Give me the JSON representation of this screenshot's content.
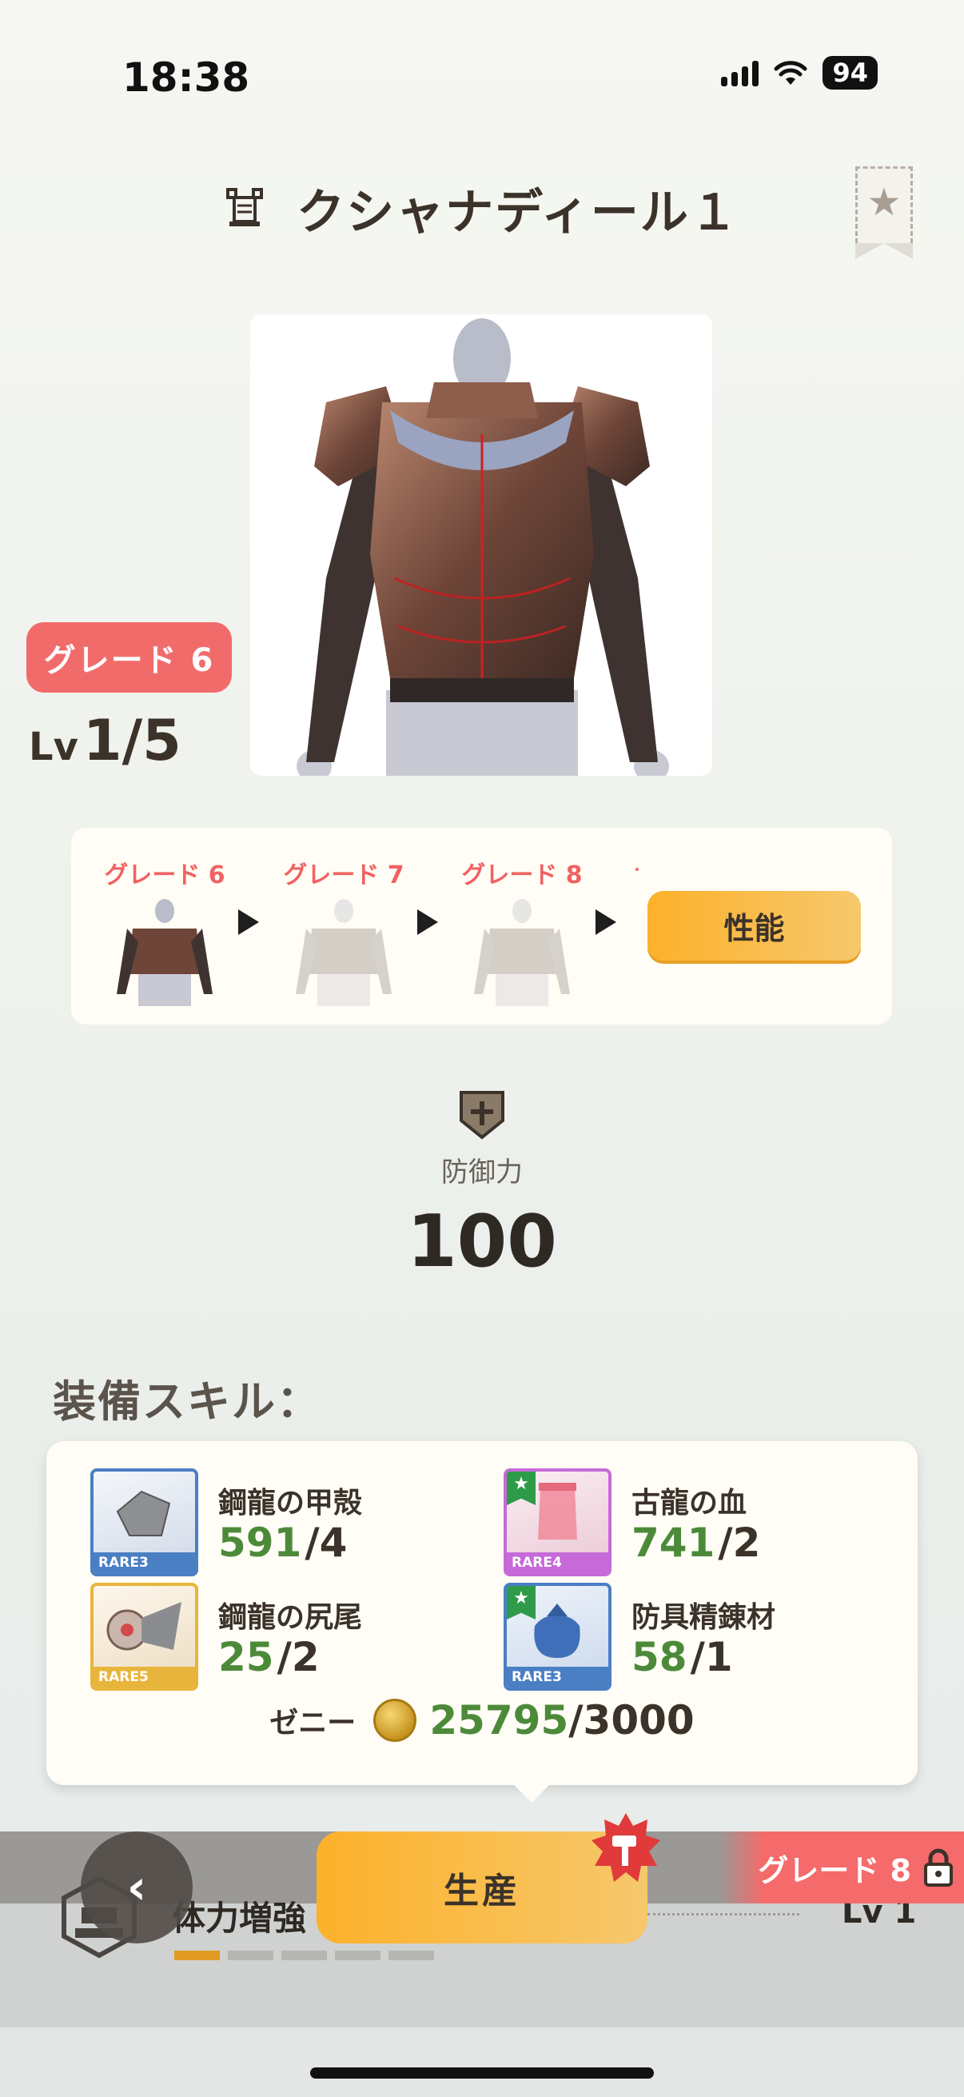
{
  "status_bar": {
    "time": "18:38",
    "battery": "94"
  },
  "header": {
    "title": "クシャナディール１"
  },
  "item": {
    "grade_badge": "グレード 6",
    "level_prefix": "Lv",
    "level_value": "1/5"
  },
  "grade_track": {
    "stages": [
      {
        "label": "グレード 6"
      },
      {
        "label": "グレード 7"
      },
      {
        "label": "グレード 8"
      }
    ],
    "performance_button": "性能"
  },
  "defense": {
    "label": "防御力",
    "value": "100"
  },
  "skills_title": "装備スキル：",
  "materials": [
    {
      "name": "鋼龍の甲殻",
      "have": "591",
      "need": "/4",
      "rarity": "RARE3",
      "rarity_color": "#4a7fc4"
    },
    {
      "name": "古龍の血",
      "have": "741",
      "need": "/2",
      "rarity": "RARE4",
      "rarity_color": "#c56ad8"
    },
    {
      "name": "鋼龍の尻尾",
      "have": "25",
      "need": "/2",
      "rarity": "RARE5",
      "rarity_color": "#e8b53c"
    },
    {
      "name": "防具精錬材",
      "have": "58",
      "need": "/1",
      "rarity": "RARE3",
      "rarity_color": "#4a7fc4"
    }
  ],
  "zeny": {
    "label": "ゼニー",
    "have": "25795",
    "need": "/3000"
  },
  "bottom": {
    "skill_name": "体力増強",
    "skill_level": "Lv 1",
    "skill_progress_segments": 5,
    "skill_progress_filled": 1,
    "produce_button": "生産",
    "grade_lock": "グレード 8"
  },
  "colors": {
    "accent": "#fdb12a",
    "grade_red": "#f26b6b",
    "have_green": "#4c8a3a"
  }
}
